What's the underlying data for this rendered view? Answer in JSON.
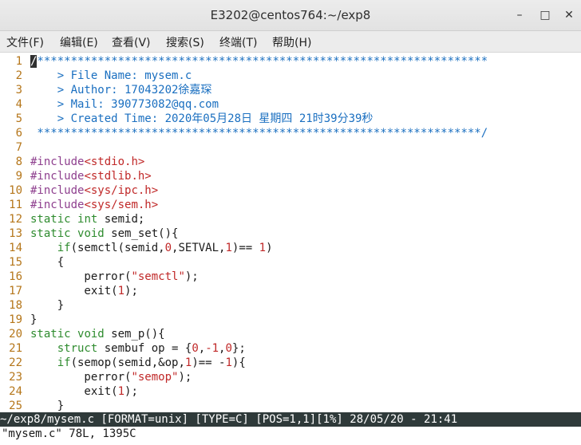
{
  "window": {
    "title": "E3202@centos764:~/exp8",
    "controls": [
      "minimize-icon",
      "maximize-icon",
      "close-icon"
    ]
  },
  "menu": [
    {
      "label": "文件(F)"
    },
    {
      "label": "编辑(E)"
    },
    {
      "label": "查看(V)"
    },
    {
      "label": "搜索(S)"
    },
    {
      "label": "终端(T)"
    },
    {
      "label": "帮助(H)"
    }
  ],
  "editor": {
    "lines": [
      {
        "n": "1",
        "tokens": [
          {
            "t": "c",
            "v": "/*******************************************************************"
          }
        ],
        "cursor": true
      },
      {
        "n": "2",
        "tokens": [
          {
            "t": "c",
            "v": "    > File Name: mysem.c"
          }
        ]
      },
      {
        "n": "3",
        "tokens": [
          {
            "t": "c",
            "v": "    > Author: 17043202徐嘉琛"
          }
        ]
      },
      {
        "n": "4",
        "tokens": [
          {
            "t": "c",
            "v": "    > Mail: 390773082@qq.com"
          }
        ]
      },
      {
        "n": "5",
        "tokens": [
          {
            "t": "c",
            "v": "    > Created Time: 2020年05月28日 星期四 21时39分39秒"
          }
        ]
      },
      {
        "n": "6",
        "tokens": [
          {
            "t": "c",
            "v": " ******************************************************************/"
          }
        ]
      },
      {
        "n": "7",
        "tokens": []
      },
      {
        "n": "8",
        "tokens": [
          {
            "t": "p",
            "v": "#include"
          },
          {
            "t": "s",
            "v": "<stdio.h>"
          }
        ]
      },
      {
        "n": "9",
        "tokens": [
          {
            "t": "p",
            "v": "#include"
          },
          {
            "t": "s",
            "v": "<stdlib.h>"
          }
        ]
      },
      {
        "n": "10",
        "tokens": [
          {
            "t": "p",
            "v": "#include"
          },
          {
            "t": "s",
            "v": "<sys/ipc.h>"
          }
        ]
      },
      {
        "n": "11",
        "tokens": [
          {
            "t": "p",
            "v": "#include"
          },
          {
            "t": "s",
            "v": "<sys/sem.h>"
          }
        ]
      },
      {
        "n": "12",
        "tokens": [
          {
            "t": "k",
            "v": "static"
          },
          {
            "t": "x",
            "v": " "
          },
          {
            "t": "k",
            "v": "int"
          },
          {
            "t": "x",
            "v": " semid;"
          }
        ]
      },
      {
        "n": "13",
        "tokens": [
          {
            "t": "k",
            "v": "static"
          },
          {
            "t": "x",
            "v": " "
          },
          {
            "t": "k",
            "v": "void"
          },
          {
            "t": "x",
            "v": " sem_set(){"
          }
        ]
      },
      {
        "n": "14",
        "tokens": [
          {
            "t": "x",
            "v": "    "
          },
          {
            "t": "k",
            "v": "if"
          },
          {
            "t": "x",
            "v": "(semctl(semid,"
          },
          {
            "t": "n",
            "v": "0"
          },
          {
            "t": "x",
            "v": ",SETVAL,"
          },
          {
            "t": "n",
            "v": "1"
          },
          {
            "t": "x",
            "v": ")== "
          },
          {
            "t": "n",
            "v": "1"
          },
          {
            "t": "x",
            "v": ")"
          }
        ]
      },
      {
        "n": "15",
        "tokens": [
          {
            "t": "x",
            "v": "    {"
          }
        ]
      },
      {
        "n": "16",
        "tokens": [
          {
            "t": "x",
            "v": "        perror("
          },
          {
            "t": "s",
            "v": "\"semctl\""
          },
          {
            "t": "x",
            "v": ");"
          }
        ]
      },
      {
        "n": "17",
        "tokens": [
          {
            "t": "x",
            "v": "        exit("
          },
          {
            "t": "n",
            "v": "1"
          },
          {
            "t": "x",
            "v": ");"
          }
        ]
      },
      {
        "n": "18",
        "tokens": [
          {
            "t": "x",
            "v": "    }"
          }
        ]
      },
      {
        "n": "19",
        "tokens": [
          {
            "t": "x",
            "v": "}"
          }
        ]
      },
      {
        "n": "20",
        "tokens": [
          {
            "t": "k",
            "v": "static"
          },
          {
            "t": "x",
            "v": " "
          },
          {
            "t": "k",
            "v": "void"
          },
          {
            "t": "x",
            "v": " sem_p(){"
          }
        ]
      },
      {
        "n": "21",
        "tokens": [
          {
            "t": "x",
            "v": "    "
          },
          {
            "t": "k",
            "v": "struct"
          },
          {
            "t": "x",
            "v": " sembuf op = {"
          },
          {
            "t": "n",
            "v": "0"
          },
          {
            "t": "x",
            "v": ","
          },
          {
            "t": "n",
            "v": "-1"
          },
          {
            "t": "x",
            "v": ","
          },
          {
            "t": "n",
            "v": "0"
          },
          {
            "t": "x",
            "v": "};"
          }
        ]
      },
      {
        "n": "22",
        "tokens": [
          {
            "t": "x",
            "v": "    "
          },
          {
            "t": "k",
            "v": "if"
          },
          {
            "t": "x",
            "v": "(semop(semid,&op,"
          },
          {
            "t": "n",
            "v": "1"
          },
          {
            "t": "x",
            "v": ")== -"
          },
          {
            "t": "n",
            "v": "1"
          },
          {
            "t": "x",
            "v": "){"
          }
        ]
      },
      {
        "n": "23",
        "tokens": [
          {
            "t": "x",
            "v": "        perror("
          },
          {
            "t": "s",
            "v": "\"semop\""
          },
          {
            "t": "x",
            "v": ");"
          }
        ]
      },
      {
        "n": "24",
        "tokens": [
          {
            "t": "x",
            "v": "        exit("
          },
          {
            "t": "n",
            "v": "1"
          },
          {
            "t": "x",
            "v": ");"
          }
        ]
      },
      {
        "n": "25",
        "tokens": [
          {
            "t": "x",
            "v": "    }"
          }
        ]
      }
    ]
  },
  "status": {
    "text": "~/exp8/mysem.c [FORMAT=unix] [TYPE=C] [POS=1,1][1%] 28/05/20 - 21:41"
  },
  "cmdline": {
    "text": "\"mysem.c\" 78L, 1395C"
  },
  "colors": {
    "comment": "#1a6fc0",
    "preprocessor": "#8e3f8e",
    "string": "#c02828",
    "keyword": "#2e8b2e",
    "line_number": "#b5761a",
    "status_bg": "#2f3a3a"
  }
}
